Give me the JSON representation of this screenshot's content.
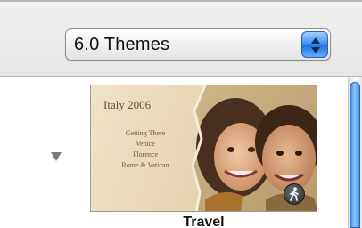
{
  "theme_selector": {
    "value": "6.0 Themes"
  },
  "theme": {
    "thumbnail": {
      "title": "Italy 2006",
      "items": [
        "Getting There",
        "Venice",
        "Florence",
        "Rome & Vatican"
      ],
      "badge_icon": "walking-person-icon"
    },
    "label": "Travel"
  },
  "icons": {
    "disclosure": "disclosure-triangle-down-icon",
    "popup_arrows": "up-down-arrows-icon"
  },
  "colors": {
    "accent": "#3d8ff2",
    "thumbnail_background": "#e7d6b4"
  }
}
